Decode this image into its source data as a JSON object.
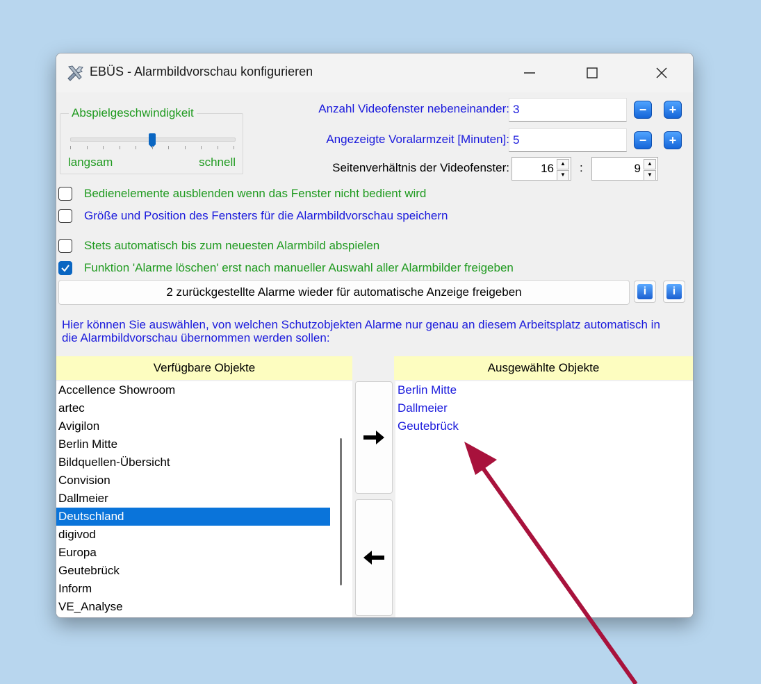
{
  "window": {
    "title": "EBÜS - Alarmbildvorschau konfigurieren",
    "icon": "tools-icon",
    "controls": [
      "minimize-icon",
      "maximize-icon",
      "close-icon"
    ]
  },
  "playback_speed": {
    "label": "Abspielgeschwindigkeit",
    "min_label": "langsam",
    "max_label": "schnell",
    "value_fraction": 0.5
  },
  "settings": {
    "video_count_label": "Anzahl Videofenster nebeneinander:",
    "video_count_value": "3",
    "prealarm_label": "Angezeigte Voralarmzeit [Minuten]:",
    "prealarm_value": "5",
    "aspect_label": "Seitenverhältnis der Videofenster:",
    "aspect_width": "16",
    "aspect_separator": ":",
    "aspect_height": "9"
  },
  "checkboxes": [
    {
      "label": "Bedienelemente ausblenden wenn das Fenster nicht bedient wird",
      "checked": false
    },
    {
      "label": "Größe und Position des Fensters für die Alarmbildvorschau speichern",
      "checked": false
    },
    {
      "label": "Stets automatisch bis zum neuesten Alarmbild abspielen",
      "checked": false
    },
    {
      "label": "Funktion 'Alarme löschen' erst nach manueller Auswahl aller Alarmbilder freigeben",
      "checked": true
    }
  ],
  "release_button_label": "2 zurückgestellte Alarme wieder für automatische Anzeige freigeben",
  "info_text": "Hier können Sie auswählen, von welchen Schutzobjekten Alarme nur genau an diesem Arbeitsplatz automatisch in die Alarmbildvorschau übernommen werden sollen:",
  "available": {
    "header": "Verfügbare Objekte",
    "items": [
      "Accellence Showroom",
      "artec",
      "Avigilon",
      "Berlin Mitte",
      "Bildquellen-Übersicht",
      "Convision",
      "Dallmeier",
      "Deutschland",
      "digivod",
      "Europa",
      "Geutebrück",
      "Inform",
      "VE_Analyse"
    ],
    "selected_item": "Deutschland"
  },
  "chosen": {
    "header": "Ausgewählte Objekte",
    "items": [
      "Berlin Mitte",
      "Dallmeier",
      "Geutebrück"
    ]
  },
  "colors": {
    "desktop": "#b8d6ee",
    "accent": "#0a66c2",
    "annotation_arrow": "#a8123c",
    "header_bg": "#fdfdc0"
  }
}
